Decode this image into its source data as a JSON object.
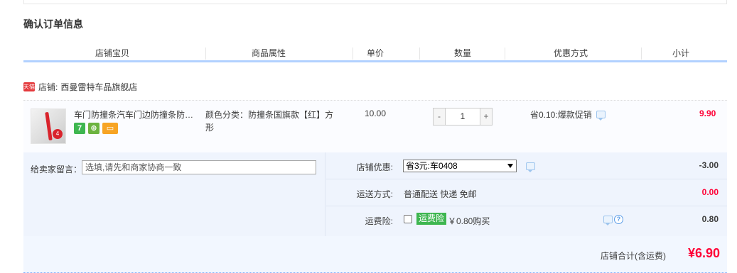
{
  "section_title": "确认订单信息",
  "columns": {
    "item": "店铺宝贝",
    "attributes": "商品属性",
    "price": "单价",
    "quantity": "数量",
    "promotion": "优惠方式",
    "subtotal": "小计"
  },
  "shop": {
    "badge": "天猫",
    "prefix": "店铺:",
    "name": "西曼雷特车品旗舰店"
  },
  "item": {
    "title": "车门防撞条汽车门边防撞条防撞贴车门边防刮蹭防擦条",
    "image_badge": "4",
    "service_icons": [
      "7",
      "⊕",
      "▭"
    ],
    "attributes": "颜色分类：防撞条国旗款【红】方形",
    "price": "10.00",
    "quantity": "1",
    "qty_minus": "-",
    "qty_plus": "+",
    "promotion": "省0.10:爆款促销",
    "subtotal": "9.90"
  },
  "memo": {
    "label": "给卖家留言：",
    "placeholder": "选填,请先和商家协商一致"
  },
  "shop_discount": {
    "label": "店铺优惠:",
    "selected": "省3元:车0408",
    "amount": "-3.00"
  },
  "shipping": {
    "label": "运送方式:",
    "value": "普通配送 快递 免邮",
    "amount": "0.00"
  },
  "insurance": {
    "label": "运费险:",
    "badge": "运费险",
    "text": "￥0.80购买",
    "help": "?",
    "amount": "0.80"
  },
  "total": {
    "label": "店铺合计(含运费)",
    "amount": "¥6.90"
  },
  "colors": {
    "price_red": "#ff0036",
    "header_border": "#b2d1ff",
    "ext_bg": "#eff4fd",
    "insurance_green": "#3eb650"
  }
}
